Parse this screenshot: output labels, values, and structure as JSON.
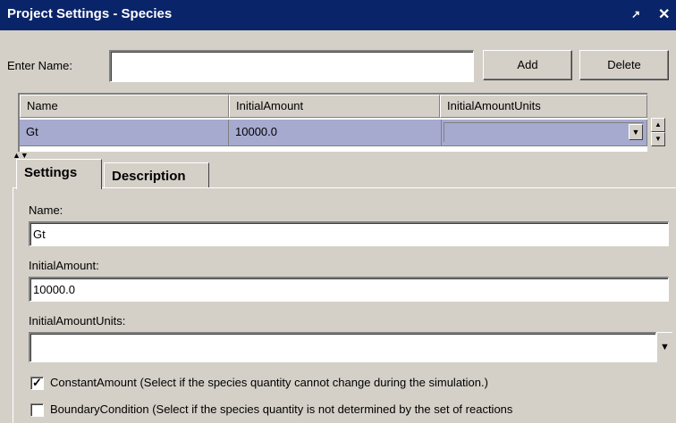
{
  "window": {
    "title": "Project Settings - Species",
    "pin_glyph": "↗",
    "close_glyph": "✕"
  },
  "toolbar": {
    "name_label": "Enter Name:",
    "name_value": "",
    "add_label": "Add",
    "delete_label": "Delete"
  },
  "table": {
    "columns": [
      "Name",
      "InitialAmount",
      "InitialAmountUnits"
    ],
    "rows": [
      {
        "name": "Gt",
        "initial_amount": "10000.0",
        "initial_amount_units": ""
      }
    ]
  },
  "tabs": [
    {
      "label": "Settings",
      "active": true
    },
    {
      "label": "Description",
      "active": false
    }
  ],
  "settings": {
    "name_label": "Name:",
    "name_value": "Gt",
    "initial_amount_label": "InitialAmount:",
    "initial_amount_value": "10000.0",
    "units_label": "InitialAmountUnits:",
    "units_value": "",
    "constant_amount": {
      "checked": true,
      "label": "ConstantAmount (Select if the species quantity cannot change during the simulation.)"
    },
    "boundary_condition": {
      "checked": false,
      "label": "BoundaryCondition (Select if the species quantity is not determined by the set of reactions"
    }
  },
  "colors": {
    "title_bar": "#0a246a",
    "selected_row": "#a6aacf",
    "window_bg": "#d4d0c8"
  }
}
